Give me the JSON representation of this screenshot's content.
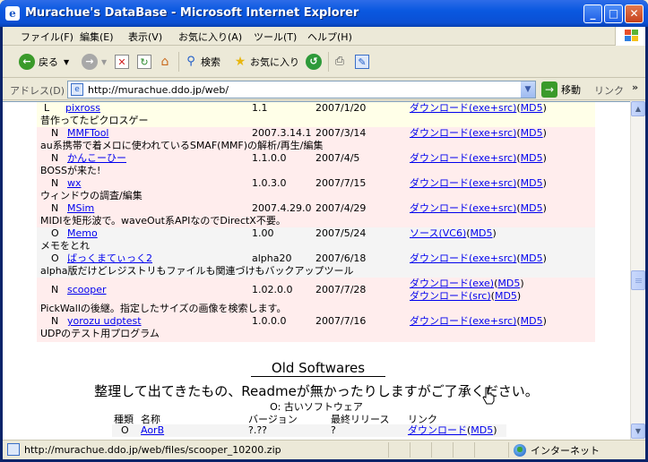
{
  "window": {
    "title": "Murachue's DataBase - Microsoft Internet Explorer"
  },
  "menu": [
    "ファイル(F)",
    "編集(E)",
    "表示(V)",
    "お気に入り(A)",
    "ツール(T)",
    "ヘルプ(H)"
  ],
  "toolbar": {
    "back": "戻る",
    "search": "検索",
    "favorites": "お気に入り"
  },
  "address": {
    "label": "アドレス(D)",
    "url": "http://murachue.ddo.jp/web/",
    "go": "移動",
    "links": "リンク"
  },
  "rows": [
    {
      "kind": "L",
      "name": "pixross",
      "version": "1.1",
      "date": "2007/1/20",
      "link1": "ダウンロード(exe+src)",
      "md5": "MD5",
      "desc": "昔作ってたピクロスゲー",
      "bg": "y"
    },
    {
      "kind": "N",
      "name": "MMFTool",
      "version": "2007.3.14.1",
      "date": "2007/3/14",
      "link1": "ダウンロード(exe+src)",
      "md5": "MD5",
      "desc": "au系携帯で着メロに使われているSMAF(MMF)の解析/再生/編集",
      "bg": "p"
    },
    {
      "kind": "N",
      "name": "かんこーひー",
      "version": "1.1.0.0",
      "date": "2007/4/5",
      "link1": "ダウンロード(exe+src)",
      "md5": "MD5",
      "desc": "BOSSが来た!",
      "bg": "p"
    },
    {
      "kind": "N",
      "name": "wx",
      "version": "1.0.3.0",
      "date": "2007/7/15",
      "link1": "ダウンロード(exe+src)",
      "md5": "MD5",
      "desc": "ウィンドウの調査/編集",
      "bg": "p"
    },
    {
      "kind": "N",
      "name": "MSim",
      "version": "2007.4.29.0",
      "date": "2007/4/29",
      "link1": "ダウンロード(exe+src)",
      "md5": "MD5",
      "desc": "MIDIを矩形波で。waveOut系APIなのでDirectX不要。",
      "bg": "p"
    },
    {
      "kind": "O",
      "name": "Memo",
      "version": "1.00",
      "date": "2007/5/24",
      "link1": "ソース(VC6)",
      "md5": "MD5",
      "desc": "メモをとれ",
      "bg": "g"
    },
    {
      "kind": "O",
      "name": "ばっくまてぃっく2",
      "version": "alpha20",
      "date": "2007/6/18",
      "link1": "ダウンロード(exe+src)",
      "md5": "MD5",
      "desc": "alpha版だけどレジストリもファイルも関連づけもバックアップツール",
      "bg": "g"
    },
    {
      "kind": "N",
      "name": "scooper",
      "version": "1.02.0.0",
      "date": "2007/7/28",
      "link1": "ダウンロード(exe)",
      "md5": "MD5",
      "link2": "ダウンロード(src)",
      "md5b": "MD5",
      "desc": "PickWallの後継。指定したサイズの画像を検索します。",
      "bg": "p"
    },
    {
      "kind": "N",
      "name": "yorozu udptest",
      "version": "1.0.0.0",
      "date": "2007/7/16",
      "link1": "ダウンロード(exe+src)",
      "md5": "MD5",
      "desc": "UDPのテスト用プログラム",
      "bg": "p"
    }
  ],
  "old": {
    "title": "Old Softwares",
    "desc": "整理して出てきたもの、Readmeが無かったりしますがご了承ください。",
    "legend": "O: 古いソフトウェア",
    "headers": {
      "kind": "種類",
      "name": "名称",
      "version": "バージョン",
      "date": "最終リリース",
      "link": "リンク"
    },
    "first": {
      "kind": "O",
      "name": "AorB",
      "version": "?.??",
      "date": "?",
      "link1": "ダウンロード",
      "md5": "MD5"
    }
  },
  "status": {
    "text": "http://murachue.ddo.jp/web/files/scooper_10200.zip",
    "zone": "インターネット"
  }
}
